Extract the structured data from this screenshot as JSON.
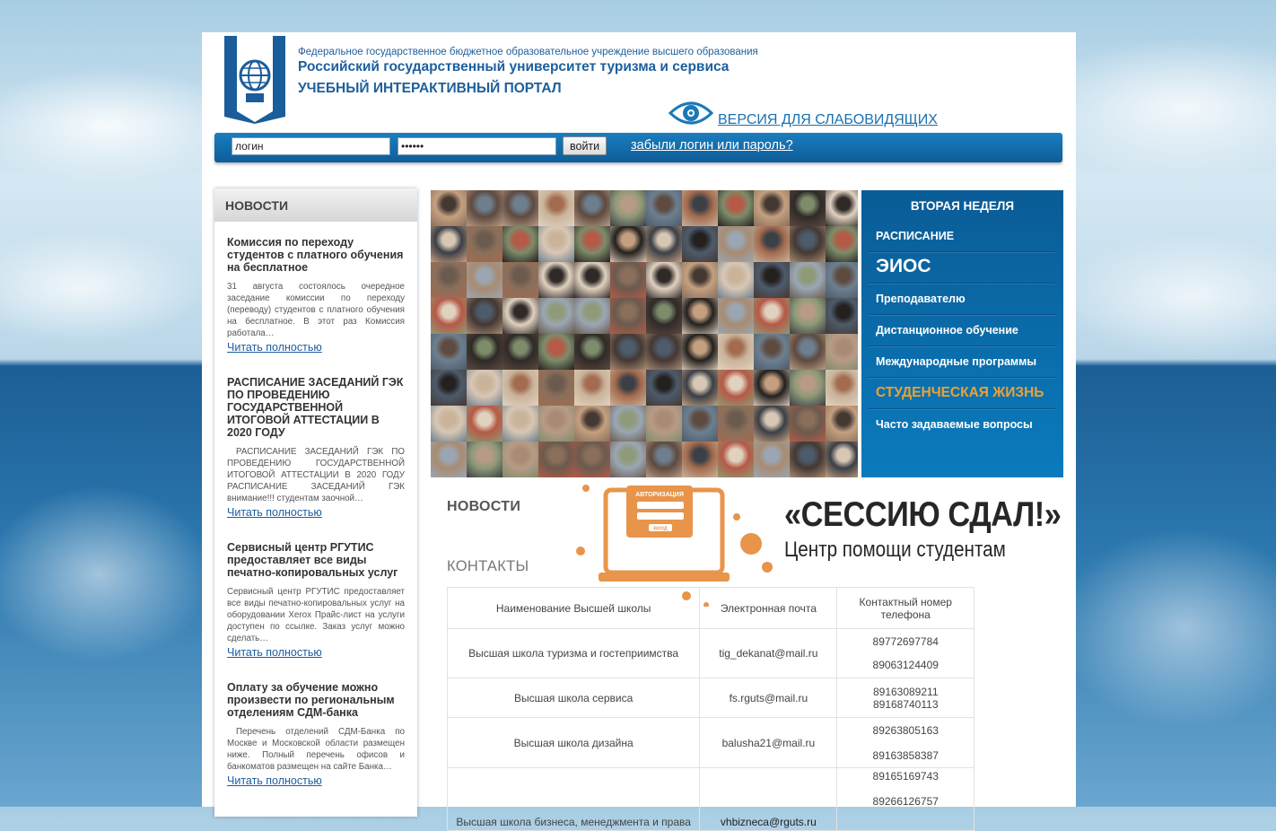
{
  "header": {
    "subtitle": "Федеральное государственное бюджетное образовательное учреждение высшего образования",
    "university": "Российский государственный университет туризма и сервиса",
    "portal": "УЧЕБНЫЙ ИНТЕРАКТИВНЫЙ ПОРТАЛ",
    "low_vision": "ВЕРСИЯ ДЛЯ СЛАБОВИДЯЩИХ"
  },
  "login": {
    "login_value": "логин",
    "password_value": "••••••",
    "submit": "войти",
    "forgot": "забыли логин или пароль?"
  },
  "news_sidebar": {
    "heading": "НОВОСТИ",
    "items": [
      {
        "title": "Комиссия по переходу студентов с платного обучения на бесплатное",
        "text": "31 августа состоялось очередное заседание комиссии по переходу (переводу) студентов с платного обучения на бесплатное. В этот раз Комиссия работала…",
        "more": "Читать полностью"
      },
      {
        "title": "РАСПИСАНИЕ ЗАСЕДАНИЙ ГЭК ПО ПРОВЕДЕНИЮ ГОСУДАРСТВЕННОЙ ИТОГОВОЙ АТТЕСТАЦИИ В 2020 ГОДУ",
        "text": "РАСПИСАНИЕ ЗАСЕДАНИЙ ГЭК ПО ПРОВЕДЕНИЮ ГОСУДАРСТВЕННОЙ ИТОГОВОЙ АТТЕСТАЦИИ В 2020 ГОДУ РАСПИСАНИЕ ЗАСЕДАНИЙ ГЭК внимание!!! студентам заочной…",
        "more": "Читать полностью"
      },
      {
        "title": "Сервисный центр РГУТИС предоставляет все виды печатно-копировальных услуг",
        "text": "Сервисный центр РГУТИС предоставляет все виды печатно-копировальных услуг на оборудовании Xerox Прайс-лист на услуги доступен по ссылке. Заказ услуг можно сделать…",
        "more": "Читать полностью"
      },
      {
        "title": "Оплату за обучение можно произвести по региональным отделениям СДМ-банка",
        "text": "Перечень отделений СДМ-Банка по Москве и Московской области размещен ниже. Полный перечень офисов и банкоматов размещен на сайте Банка…",
        "more": "Читать полностью"
      }
    ]
  },
  "menu": {
    "week": "ВТОРАЯ НЕДЕЛЯ",
    "items": [
      "РАСПИСАНИЕ",
      "ЭИОС",
      "Преподавателю",
      "Дистанционное обучение",
      "Международные программы",
      "СТУДЕНЧЕСКАЯ ЖИЗНЬ",
      "Часто задаваемые вопросы"
    ]
  },
  "center": {
    "news_heading": "НОВОСТИ",
    "contacts_heading": "КОНТАКТЫ"
  },
  "banner": {
    "title": "«СЕССИЮ СДАЛ!»",
    "subtitle": "Центр помощи студентам",
    "screen_label": "АВТОРИЗАЦИЯ",
    "screen_button": "ВХОД"
  },
  "contacts_table": {
    "headers": [
      "Наименование Высшей школы",
      "Электронная почта",
      "Контактный номер телефона"
    ],
    "rows": [
      {
        "name": "Высшая школа туризма и гостеприимства",
        "email": "tig_dekanat@mail.ru",
        "phones": [
          "89772697784",
          "89063124409"
        ]
      },
      {
        "name": "Высшая школа сервиса",
        "email": "fs.rguts@mail.ru",
        "phones": [
          "89163089211",
          "89168740113"
        ]
      },
      {
        "name": "Высшая школа дизайна",
        "email": "balusha21@mail.ru",
        "phones": [
          "89263805163",
          "89163858387"
        ]
      },
      {
        "name": "Высшая школа бизнеса, менеджмента и права",
        "email": "vhbizneca@rguts.ru",
        "phones": [
          "89165169743",
          "89266126757"
        ]
      }
    ]
  },
  "colors": {
    "brand_blue": "#1e5f9c",
    "bar_blue": "#0e5d98",
    "menu_orange": "#f0a030",
    "banner_orange": "#e8944a"
  }
}
